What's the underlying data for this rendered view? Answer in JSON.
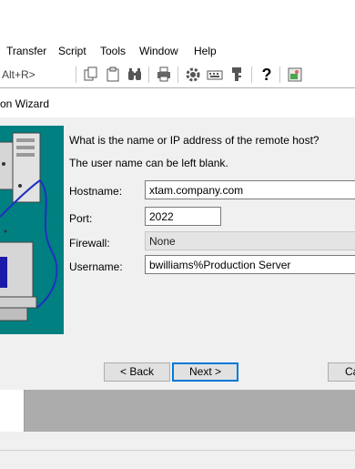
{
  "menu": {
    "items": [
      {
        "label": "Transfer"
      },
      {
        "label": "Script"
      },
      {
        "label": "Tools"
      },
      {
        "label": "Window"
      },
      {
        "label": "Help"
      }
    ]
  },
  "toolbar": {
    "shortcut_text": "Alt+R>",
    "icons": [
      "copy-icon",
      "paste-icon",
      "find-icon",
      "print-icon",
      "settings-icon",
      "keymap-icon",
      "key-icon",
      "help-icon",
      "sftp-icon"
    ],
    "help_glyph": "?"
  },
  "dialog": {
    "title": "on Wizard",
    "prompt": "What is the name or IP address of the remote host?",
    "hint": "The user name can be left blank.",
    "hostname_label": "Hostname:",
    "hostname_value": "xtam.company.com",
    "port_label": "Port:",
    "port_value": "2022",
    "firewall_label": "Firewall:",
    "firewall_value": "None",
    "username_label": "Username:",
    "username_value": "bwilliams%Production Server",
    "back_label": "< Back",
    "next_label": "Next >",
    "cancel_label": "Ca"
  },
  "colors": {
    "teal": "#008080",
    "focus_blue": "#0078d7"
  }
}
